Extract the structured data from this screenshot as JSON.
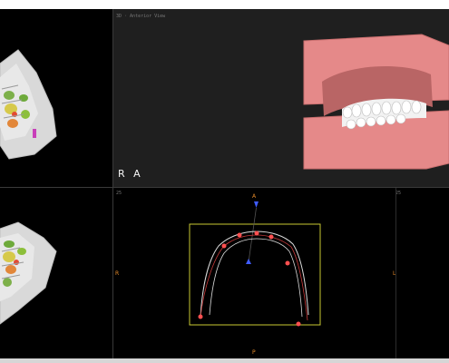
{
  "viewer": {
    "top_right_label": "3D · Anterior View",
    "orientation_badge": "R A",
    "axial_labels": {
      "anterior": "A",
      "posterior": "P",
      "right": "R",
      "left": "L"
    },
    "corner_indices": {
      "left": "25",
      "right": "25"
    }
  },
  "colors": {
    "gum": "#e58989",
    "teeth": "#f2f2f2",
    "landmark": "#ff5050",
    "guide_box": "#c8c832",
    "axis_marker": "#3f5cff",
    "orientation_text": "#e58b2a"
  },
  "icons": [
    "dental-model-3d",
    "landmark-point",
    "axis-marker"
  ]
}
